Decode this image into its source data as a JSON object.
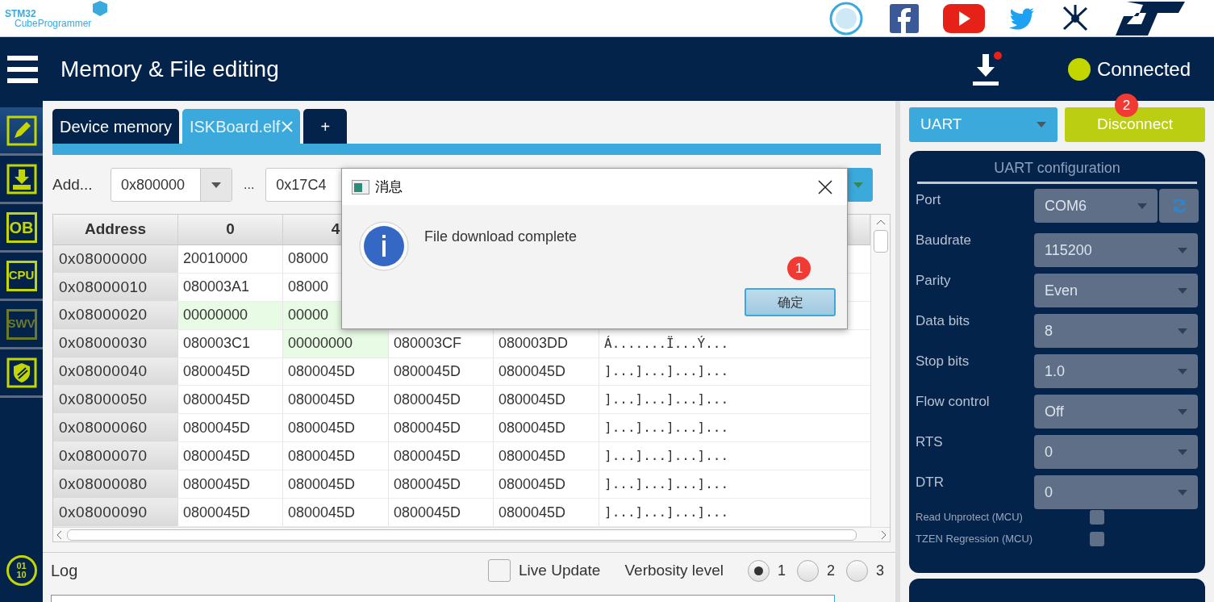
{
  "logo": {
    "brand": "STM32",
    "product": "CubeProgrammer"
  },
  "header": {
    "title": "Memory & File editing",
    "download_alert": true,
    "status": "Connected",
    "connected": true
  },
  "sidebar": [
    {
      "kind": "edit",
      "selected": true,
      "disabled": false
    },
    {
      "kind": "download",
      "selected": false,
      "disabled": false
    },
    {
      "kind": "text",
      "label": "OB",
      "selected": false,
      "disabled": false
    },
    {
      "kind": "text",
      "label": "CPU",
      "selected": false,
      "disabled": false
    },
    {
      "kind": "text",
      "label": "SWV",
      "selected": false,
      "disabled": true
    },
    {
      "kind": "shield",
      "selected": false,
      "disabled": false
    }
  ],
  "sidebar_bottom": {
    "lines": [
      "01",
      "10"
    ]
  },
  "tabs": [
    {
      "kind": "file",
      "label": "Device memory",
      "selected": false,
      "closable": false
    },
    {
      "kind": "file",
      "label": "ISKBoard.elf",
      "selected": true,
      "closable": true
    },
    {
      "kind": "add",
      "label": "+",
      "selected": false
    }
  ],
  "toolbar": {
    "address_label": "Add...",
    "address": "0x800000",
    "separator": "...",
    "size": "0x17C4"
  },
  "table": {
    "address_header": "Address",
    "columns": [
      "0",
      "4"
    ],
    "rows": [
      {
        "address": "0x08000000",
        "cells": [
          {
            "value": "20010000",
            "highlighted": false
          },
          {
            "value": "08000",
            "highlighted": false
          }
        ]
      },
      {
        "address": "0x08000010",
        "cells": [
          {
            "value": "080003A1",
            "highlighted": false
          },
          {
            "value": "08000",
            "highlighted": false
          }
        ]
      },
      {
        "address": "0x08000020",
        "cells": [
          {
            "value": "00000000",
            "highlighted": true
          },
          {
            "value": "00000",
            "highlighted": true
          }
        ]
      },
      {
        "address": "0x08000030",
        "cells": [
          {
            "value": "080003C1",
            "highlighted": false
          },
          {
            "value": "00000000",
            "highlighted": true
          },
          {
            "value": "080003CF",
            "highlighted": false
          },
          {
            "value": "080003DD",
            "highlighted": false
          }
        ],
        "ascii": "Á.......Ï...Ý..."
      },
      {
        "address": "0x08000040",
        "cells": [
          {
            "value": "0800045D",
            "highlighted": false
          },
          {
            "value": "0800045D",
            "highlighted": false
          },
          {
            "value": "0800045D",
            "highlighted": false
          },
          {
            "value": "0800045D",
            "highlighted": false
          }
        ],
        "ascii": "]...]...]...]..."
      },
      {
        "address": "0x08000050",
        "cells": [
          {
            "value": "0800045D",
            "highlighted": false
          },
          {
            "value": "0800045D",
            "highlighted": false
          },
          {
            "value": "0800045D",
            "highlighted": false
          },
          {
            "value": "0800045D",
            "highlighted": false
          }
        ],
        "ascii": "]...]...]...]..."
      },
      {
        "address": "0x08000060",
        "cells": [
          {
            "value": "0800045D",
            "highlighted": false
          },
          {
            "value": "0800045D",
            "highlighted": false
          },
          {
            "value": "0800045D",
            "highlighted": false
          },
          {
            "value": "0800045D",
            "highlighted": false
          }
        ],
        "ascii": "]...]...]...]..."
      },
      {
        "address": "0x08000070",
        "cells": [
          {
            "value": "0800045D",
            "highlighted": false
          },
          {
            "value": "0800045D",
            "highlighted": false
          },
          {
            "value": "0800045D",
            "highlighted": false
          },
          {
            "value": "0800045D",
            "highlighted": false
          }
        ],
        "ascii": "]...]...]...]..."
      },
      {
        "address": "0x08000080",
        "cells": [
          {
            "value": "0800045D",
            "highlighted": false
          },
          {
            "value": "0800045D",
            "highlighted": false
          },
          {
            "value": "0800045D",
            "highlighted": false
          },
          {
            "value": "0800045D",
            "highlighted": false
          }
        ],
        "ascii": "]...]...]...]..."
      },
      {
        "address": "0x08000090",
        "cells": [
          {
            "value": "0800045D",
            "highlighted": false
          },
          {
            "value": "0800045D",
            "highlighted": false
          },
          {
            "value": "0800045D",
            "highlighted": false
          },
          {
            "value": "0800045D",
            "highlighted": false
          }
        ],
        "ascii": "]...]...]...]..."
      }
    ]
  },
  "dialog": {
    "title": "消息",
    "message": "File download complete",
    "ok": "确定",
    "badge": "1"
  },
  "connection": {
    "interface": "UART",
    "action": "Disconnect",
    "badge": "2"
  },
  "config": {
    "title": "UART configuration",
    "disabled": true,
    "fields": [
      {
        "kind": "select_refresh",
        "label": "Port",
        "value": "COM6"
      },
      {
        "kind": "select",
        "label": "Baudrate",
        "value": "115200"
      },
      {
        "kind": "select",
        "label": "Parity",
        "value": "Even"
      },
      {
        "kind": "select",
        "label": "Data bits",
        "value": "8"
      },
      {
        "kind": "select",
        "label": "Stop bits",
        "value": "1.0"
      },
      {
        "kind": "select",
        "label": "Flow control",
        "value": "Off"
      },
      {
        "kind": "select",
        "label": "RTS",
        "value": "0"
      },
      {
        "kind": "select",
        "label": "DTR",
        "value": "0"
      }
    ],
    "checkboxes": [
      {
        "label": "Read Unprotect (MCU)",
        "checked": false
      },
      {
        "label": "TZEN Regression (MCU)",
        "checked": false
      }
    ]
  },
  "log": {
    "title": "Log",
    "live_update": {
      "label": "Live Update",
      "checked": false
    },
    "verbosity_label": "Verbosity level",
    "levels": [
      {
        "label": "1",
        "selected": true
      },
      {
        "label": "2",
        "selected": false
      },
      {
        "label": "3",
        "selected": false
      }
    ]
  }
}
